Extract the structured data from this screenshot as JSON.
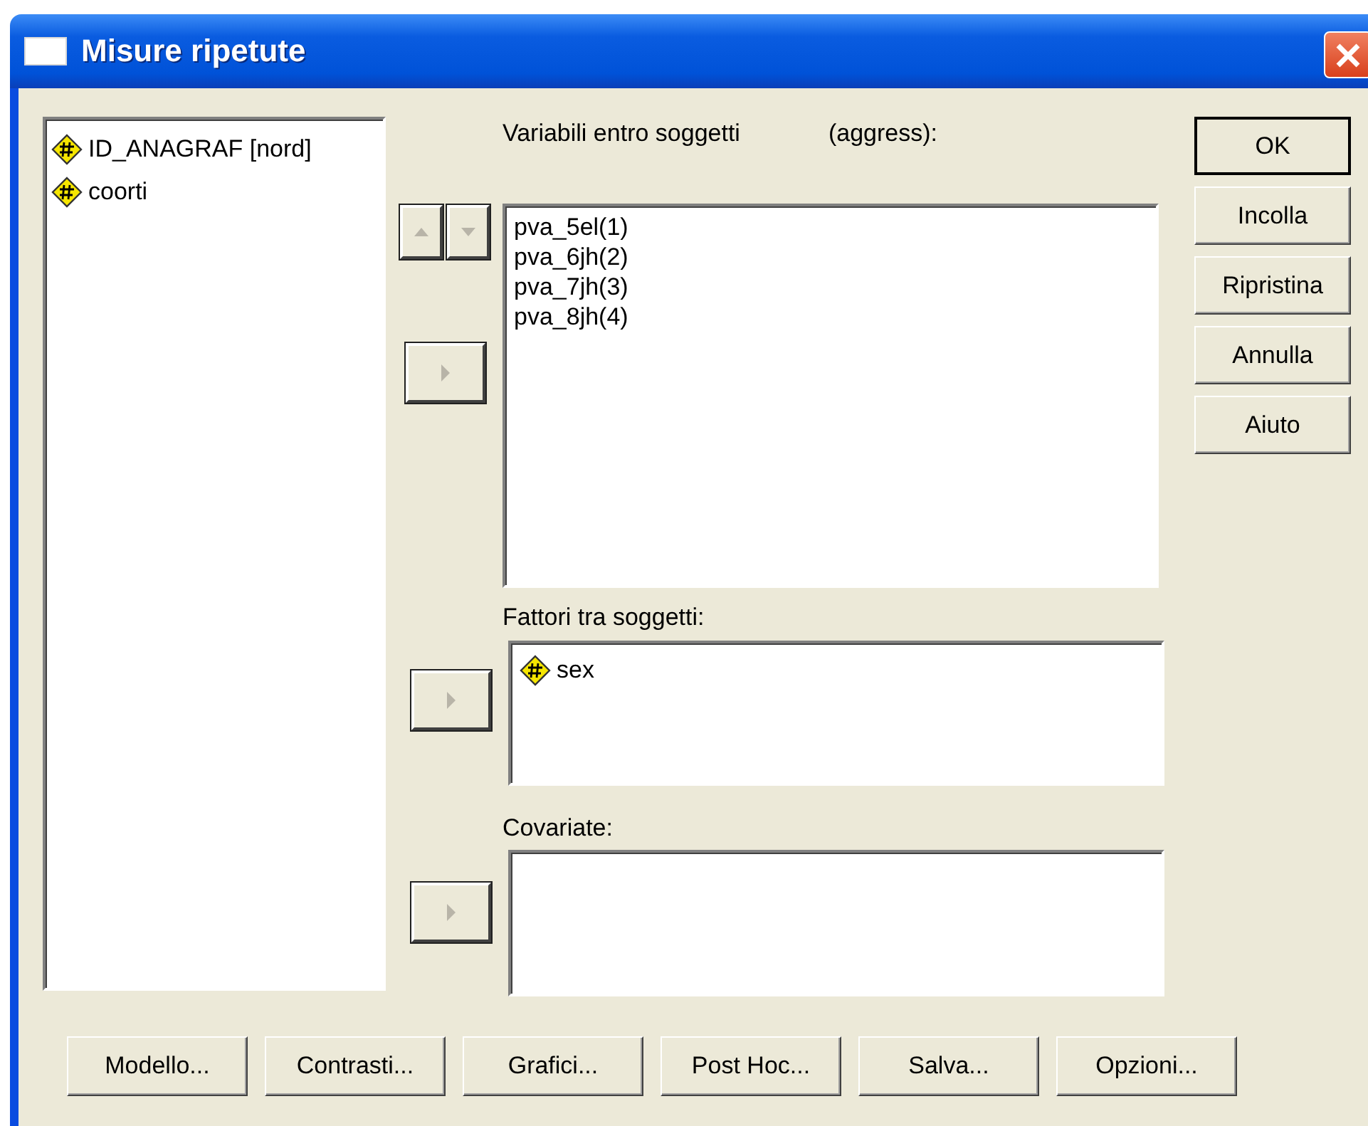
{
  "window": {
    "title": "Misure ripetute"
  },
  "source_variables": [
    {
      "name": "ID_ANAGRAF [nord]"
    },
    {
      "name": "coorti"
    }
  ],
  "move_buttons": [
    {
      "kind": "up",
      "disabled": true
    },
    {
      "kind": "down",
      "disabled": true
    },
    {
      "kind": "right",
      "disabled": true
    },
    {
      "kind": "right",
      "disabled": true
    },
    {
      "kind": "right",
      "disabled": true
    }
  ],
  "within_subjects": {
    "label": "Variabili entro soggetti",
    "factor": "(aggress):",
    "items": [
      "pva_5el(1)",
      "pva_6jh(2)",
      "pva_7jh(3)",
      "pva_8jh(4)"
    ]
  },
  "between_factors": {
    "label": "Fattori tra soggetti:",
    "items": [
      {
        "name": "sex"
      }
    ]
  },
  "covariates": {
    "label": "Covariate:"
  },
  "side_buttons": [
    {
      "label": "OK",
      "default": true
    },
    {
      "label": "Incolla",
      "default": false
    },
    {
      "label": "Ripristina",
      "default": false
    },
    {
      "label": "Annulla",
      "default": false
    },
    {
      "label": "Aiuto",
      "default": false
    }
  ],
  "bottom_buttons": [
    "Modello...",
    "Contrasti...",
    "Grafici...",
    "Post Hoc...",
    "Salva...",
    "Opzioni..."
  ]
}
